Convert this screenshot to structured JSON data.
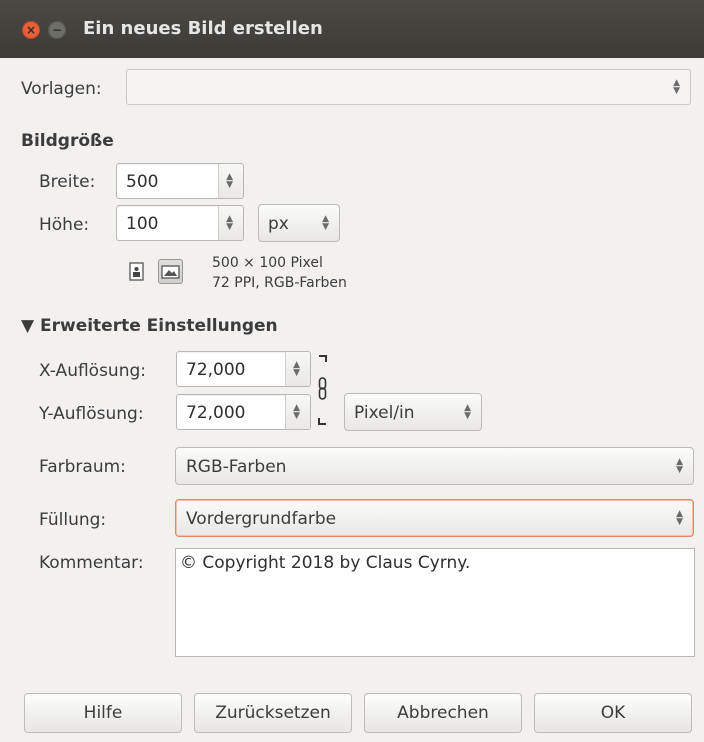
{
  "window": {
    "title": "Ein neues Bild erstellen",
    "close_glyph": "×",
    "minimize_glyph": "−"
  },
  "templates": {
    "label": "Vorlagen:",
    "value": ""
  },
  "image_size": {
    "heading": "Bildgröße",
    "width_label": "Breite:",
    "width_value": "500",
    "height_label": "Höhe:",
    "height_value": "100",
    "unit": "px",
    "info_line1": "500 × 100 Pixel",
    "info_line2": "72 PPI, RGB-Farben"
  },
  "advanced": {
    "heading": "▼ Erweiterte Einstellungen",
    "x_res_label": "X-Auflösung:",
    "x_res_value": "72,000",
    "y_res_label": "Y-Auflösung:",
    "y_res_value": "72,000",
    "res_unit": "Pixel/in",
    "colorspace_label": "Farbraum:",
    "colorspace_value": "RGB-Farben",
    "fill_label": "Füllung:",
    "fill_value": "Vordergrundfarbe",
    "comment_label": "Kommentar:",
    "comment_value": "© Copyright 2018 by Claus Cyrny."
  },
  "buttons": {
    "help": "Hilfe",
    "reset": "Zurücksetzen",
    "cancel": "Abbrechen",
    "ok": "OK"
  },
  "icons": {
    "portrait": "portrait-icon",
    "landscape": "landscape-icon",
    "chain": "chain-link-icon"
  },
  "colors": {
    "titlebar": "#3c3b37",
    "close": "#e85f39",
    "focus": "#e08a65"
  }
}
